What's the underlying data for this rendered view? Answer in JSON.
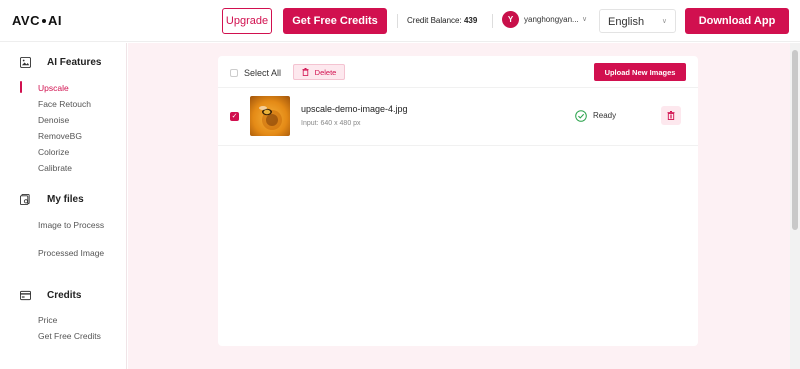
{
  "header": {
    "logo": "AVC·AI",
    "upgrade_label": "Upgrade",
    "free_credits_label": "Get Free Credits",
    "credit_balance_label": "Credit Balance:",
    "credit_balance_value": "439",
    "avatar_initial": "Y",
    "username": "yanghongyan...",
    "language": "English",
    "download_label": "Download App"
  },
  "sidebar": {
    "ai_features": {
      "title": "AI Features",
      "icon": "image-icon",
      "items": [
        "Upscale",
        "Face Retouch",
        "Denoise",
        "RemoveBG",
        "Colorize",
        "Calibrate"
      ],
      "active": "Upscale"
    },
    "my_files": {
      "title": "My files",
      "icon": "files-icon",
      "items": [
        "Image to Process",
        "Processed Image"
      ]
    },
    "credits": {
      "title": "Credits",
      "icon": "wallet-icon",
      "items": [
        "Price",
        "Get Free Credits"
      ]
    }
  },
  "toolbar": {
    "select_all_label": "Select All",
    "delete_label": "Delete",
    "upload_label": "Upload New Images"
  },
  "files": [
    {
      "name": "upscale-demo-image-4.jpg",
      "meta": "Input: 640 x 480 px",
      "status": "Ready",
      "checked": true
    }
  ],
  "colors": {
    "accent": "#d1104f",
    "main_bg": "#fdf1f4",
    "ready_green": "#2ea44f"
  }
}
